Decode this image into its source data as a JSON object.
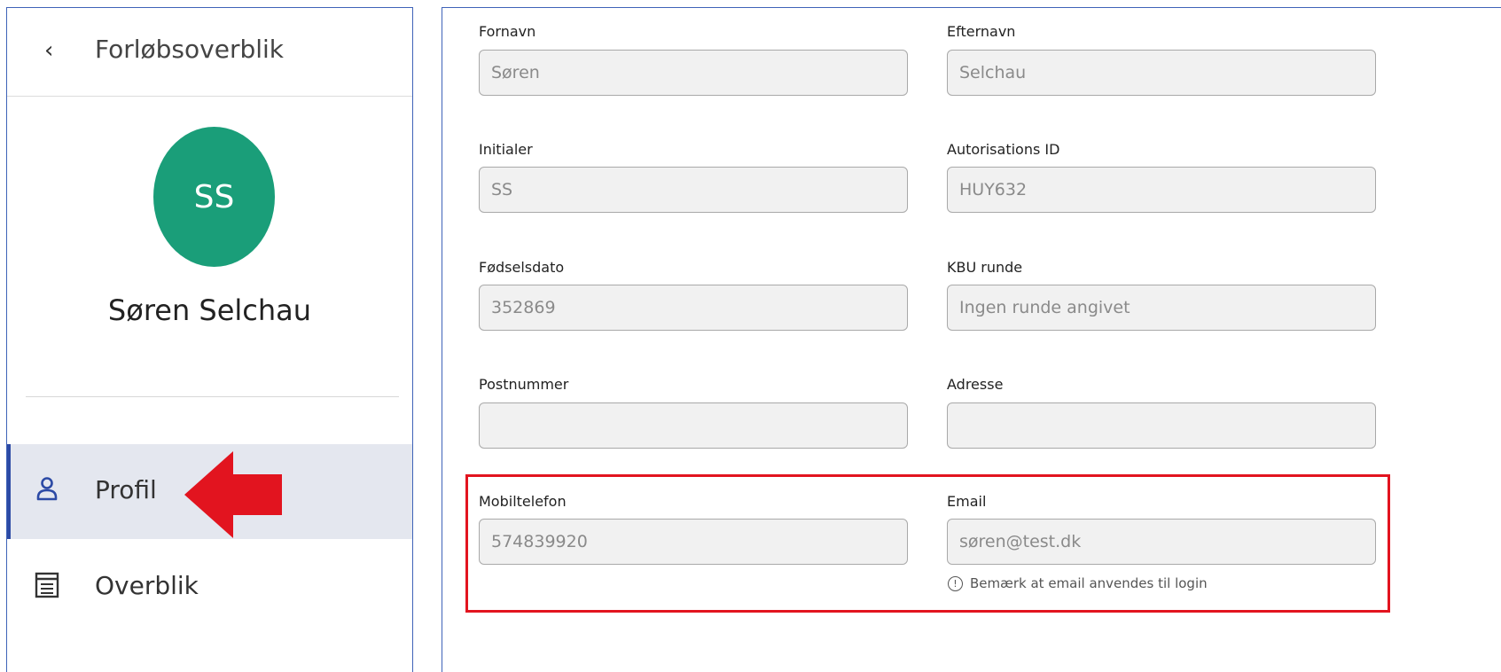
{
  "sidebar": {
    "back_label": "Forløbsoverblik",
    "avatar_initials": "SS",
    "user_name": "Søren Selchau",
    "nav": [
      {
        "label": "Profil",
        "icon": "person-icon",
        "active": true
      },
      {
        "label": "Overblik",
        "icon": "list-icon",
        "active": false
      }
    ]
  },
  "form": {
    "fornavn": {
      "label": "Fornavn",
      "value": "Søren"
    },
    "efternavn": {
      "label": "Efternavn",
      "value": "Selchau"
    },
    "initialer": {
      "label": "Initialer",
      "value": "SS"
    },
    "autorisations_id": {
      "label": "Autorisations ID",
      "value": "HUY632"
    },
    "foedselsdato": {
      "label": "Fødselsdato",
      "value": "352869"
    },
    "kbu_runde": {
      "label": "KBU runde",
      "value": "Ingen runde angivet"
    },
    "postnummer": {
      "label": "Postnummer",
      "value": ""
    },
    "adresse": {
      "label": "Adresse",
      "value": ""
    },
    "mobiltelefon": {
      "label": "Mobiltelefon",
      "value": "574839920"
    },
    "email": {
      "label": "Email",
      "value": "søren@test.dk"
    },
    "email_note": "Bemærk at email anvendes til login"
  },
  "colors": {
    "avatar": "#1a9e79",
    "accent": "#2c4aa5",
    "highlight": "#e2141f"
  }
}
